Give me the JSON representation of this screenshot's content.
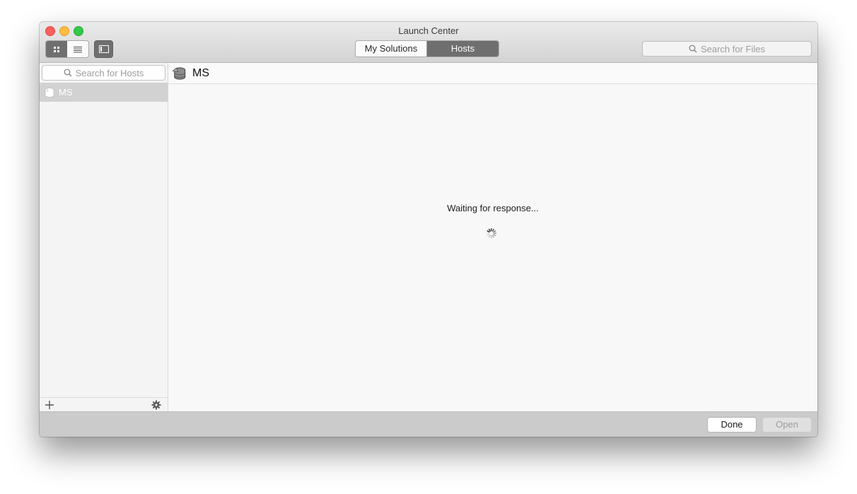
{
  "window": {
    "title": "Launch Center"
  },
  "toolbar": {
    "tabs": [
      {
        "label": "My Solutions",
        "active": false
      },
      {
        "label": "Hosts",
        "active": true
      }
    ],
    "search_files_placeholder": "Search for Files"
  },
  "sidebar": {
    "search_placeholder": "Search for Hosts",
    "hosts": [
      {
        "label": "MS",
        "selected": true
      }
    ]
  },
  "content": {
    "header_title": "MS",
    "status_text": "Waiting for response..."
  },
  "footer": {
    "done_label": "Done",
    "open_label": "Open"
  },
  "colors": {
    "selected_tab": "#6f6f6f",
    "selected_row": "#d2d2d2",
    "close": "#fc605c",
    "minimize": "#fdbc40",
    "maximize": "#34c84a"
  },
  "icons": [
    "grid-view-icon",
    "list-view-icon",
    "sidebar-toggle-icon",
    "search-icon",
    "host-icon",
    "plus-icon",
    "gear-icon",
    "spinner-icon"
  ]
}
